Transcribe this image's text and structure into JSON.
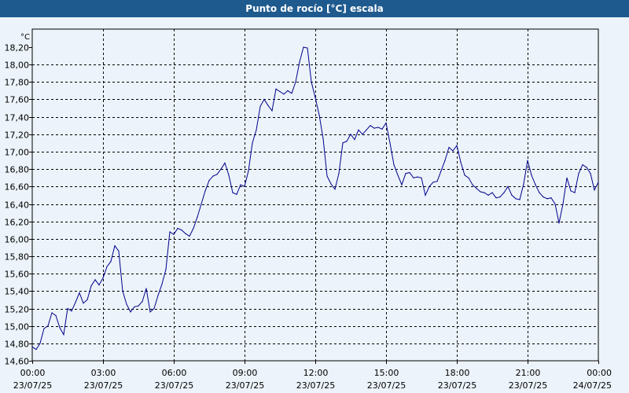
{
  "window": {
    "title": "Punto de rocío [°C] escala"
  },
  "chart_data": {
    "type": "line",
    "title": "Punto de rocío [°C] escala",
    "ylabel": "°C",
    "xlabel": "",
    "ylim": [
      14.6,
      18.3
    ],
    "yticks": [
      "18,20",
      "18,00",
      "17,80",
      "17,60",
      "17,40",
      "17,20",
      "17,00",
      "16,80",
      "16,60",
      "16,40",
      "16,20",
      "16,00",
      "15,80",
      "15,60",
      "15,40",
      "15,20",
      "15,00",
      "14,80",
      "14,60"
    ],
    "xticks": [
      {
        "time": "00:00",
        "date": "23/07/25"
      },
      {
        "time": "03:00",
        "date": "23/07/25"
      },
      {
        "time": "06:00",
        "date": "23/07/25"
      },
      {
        "time": "09:00",
        "date": "23/07/25"
      },
      {
        "time": "12:00",
        "date": "23/07/25"
      },
      {
        "time": "15:00",
        "date": "23/07/25"
      },
      {
        "time": "18:00",
        "date": "23/07/25"
      },
      {
        "time": "21:00",
        "date": "23/07/25"
      },
      {
        "time": "00:00",
        "date": "24/07/25"
      }
    ],
    "grid": true,
    "line_color": "#00008b",
    "series": [
      {
        "x": [
          "00:00",
          "00:10",
          "00:20",
          "00:30",
          "00:40",
          "00:50",
          "01:00",
          "01:10",
          "01:20",
          "01:30",
          "01:40",
          "01:50",
          "02:00",
          "02:10",
          "02:20",
          "02:30",
          "02:40",
          "02:50",
          "03:00",
          "03:10",
          "03:20",
          "03:30",
          "03:40",
          "03:50",
          "04:00",
          "04:10",
          "04:20",
          "04:30",
          "04:40",
          "04:50",
          "05:00",
          "05:10",
          "05:20",
          "05:30",
          "05:40",
          "05:50",
          "06:00",
          "06:10",
          "06:20",
          "06:30",
          "06:40",
          "06:50",
          "07:00",
          "07:10",
          "07:20",
          "07:30",
          "07:40",
          "07:50",
          "08:00",
          "08:10",
          "08:20",
          "08:30",
          "08:40",
          "08:50",
          "09:00",
          "09:10",
          "09:20",
          "09:30",
          "09:40",
          "09:50",
          "10:00",
          "10:10",
          "10:20",
          "10:30",
          "10:40",
          "10:50",
          "11:00",
          "11:10",
          "11:20",
          "11:30",
          "11:40",
          "11:50",
          "12:00",
          "12:10",
          "12:20",
          "12:30",
          "12:40",
          "12:50",
          "13:00",
          "13:10",
          "13:20",
          "13:30",
          "13:40",
          "13:50",
          "14:00",
          "14:10",
          "14:20",
          "14:30",
          "14:40",
          "14:50",
          "15:00",
          "15:10",
          "15:20",
          "15:30",
          "15:40",
          "15:50",
          "16:00",
          "16:10",
          "16:20",
          "16:30",
          "16:40",
          "16:50",
          "17:00",
          "17:10",
          "17:20",
          "17:30",
          "17:40",
          "17:50",
          "18:00",
          "18:10",
          "18:20",
          "18:30",
          "18:40",
          "18:50",
          "19:00",
          "19:10",
          "19:20",
          "19:30",
          "19:40",
          "19:50",
          "20:00",
          "20:10",
          "20:20",
          "20:30",
          "20:40",
          "20:50",
          "21:00",
          "21:10",
          "21:20",
          "21:30",
          "21:40",
          "21:50",
          "22:00",
          "22:10",
          "22:20",
          "22:30",
          "22:40",
          "22:50",
          "23:00",
          "23:10",
          "23:20",
          "23:30",
          "23:40",
          "23:50",
          "24:00"
        ],
        "values": [
          14.76,
          14.73,
          14.8,
          14.97,
          15.0,
          15.15,
          15.12,
          14.98,
          14.9,
          15.2,
          15.17,
          15.27,
          15.38,
          15.26,
          15.3,
          15.46,
          15.53,
          15.47,
          15.55,
          15.68,
          15.74,
          15.92,
          15.86,
          15.4,
          15.25,
          15.16,
          15.22,
          15.23,
          15.28,
          15.43,
          15.16,
          15.2,
          15.35,
          15.48,
          15.65,
          16.08,
          16.05,
          16.12,
          16.1,
          16.06,
          16.03,
          16.12,
          16.25,
          16.4,
          16.55,
          16.67,
          16.72,
          16.74,
          16.8,
          16.87,
          16.73,
          16.53,
          16.51,
          16.62,
          16.6,
          16.78,
          17.1,
          17.25,
          17.52,
          17.6,
          17.53,
          17.47,
          17.72,
          17.69,
          17.66,
          17.7,
          17.67,
          17.8,
          18.03,
          18.2,
          18.19,
          17.8,
          17.62,
          17.42,
          17.15,
          16.72,
          16.63,
          16.57,
          16.75,
          17.1,
          17.12,
          17.2,
          17.14,
          17.25,
          17.2,
          17.25,
          17.3,
          17.27,
          17.28,
          17.26,
          17.33,
          17.1,
          16.85,
          16.73,
          16.62,
          16.75,
          16.76,
          16.7,
          16.71,
          16.7,
          16.5,
          16.6,
          16.65,
          16.66,
          16.78,
          16.9,
          17.05,
          17.01,
          17.07,
          16.88,
          16.73,
          16.7,
          16.62,
          16.58,
          16.54,
          16.53,
          16.5,
          16.53,
          16.47,
          16.48,
          16.53,
          16.6,
          16.5,
          16.46,
          16.45,
          16.63,
          16.9,
          16.73,
          16.62,
          16.53,
          16.48,
          16.46,
          16.47,
          16.4,
          16.18,
          16.4,
          16.7,
          16.55,
          16.53,
          16.75,
          16.85,
          16.82,
          16.75,
          16.56,
          16.65
        ]
      }
    ]
  }
}
